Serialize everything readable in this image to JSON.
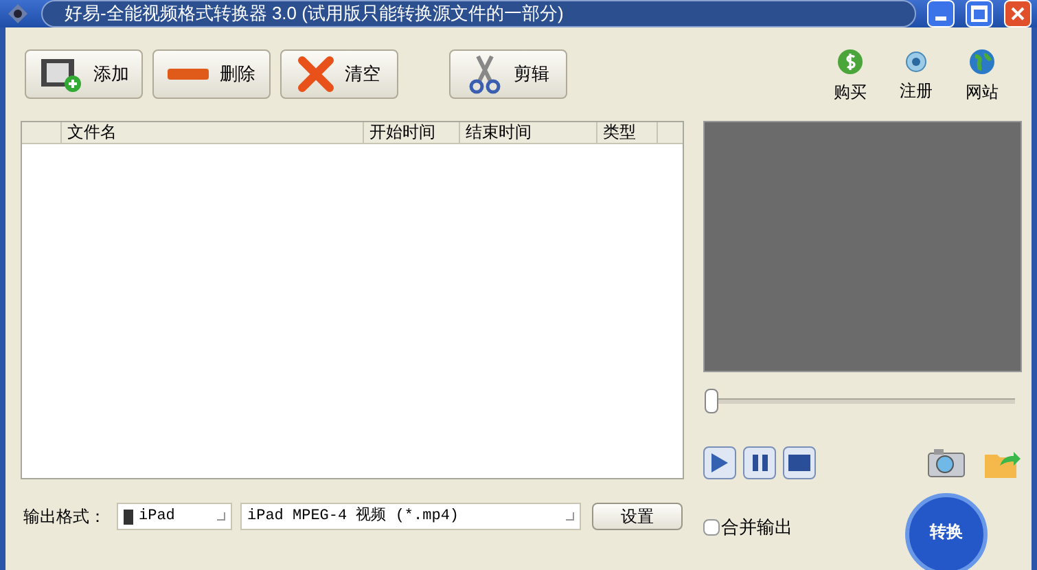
{
  "window": {
    "title": "好易-全能视频格式转换器 3.0 (试用版只能转换源文件的一部分)"
  },
  "toolbar": [
    {
      "kind": "add",
      "label": "添加"
    },
    {
      "kind": "delete",
      "label": "删除"
    },
    {
      "kind": "clear",
      "label": "清空"
    },
    {
      "kind": "cut",
      "label": "剪辑"
    }
  ],
  "links": [
    {
      "kind": "buy",
      "label": "购买"
    },
    {
      "kind": "register",
      "label": "注册"
    },
    {
      "kind": "site",
      "label": "网站"
    }
  ],
  "table": {
    "columns": [
      "文件名",
      "开始时间",
      "结束时间",
      "类型"
    ]
  },
  "player": {
    "level": 0
  },
  "output": {
    "label": "输出格式：",
    "device": "iPad",
    "format": "iPad MPEG-4 视频 (*.mp4)",
    "settings": "设置",
    "merge": {
      "label": "合并输出",
      "checked": false
    },
    "convert": "转换"
  }
}
